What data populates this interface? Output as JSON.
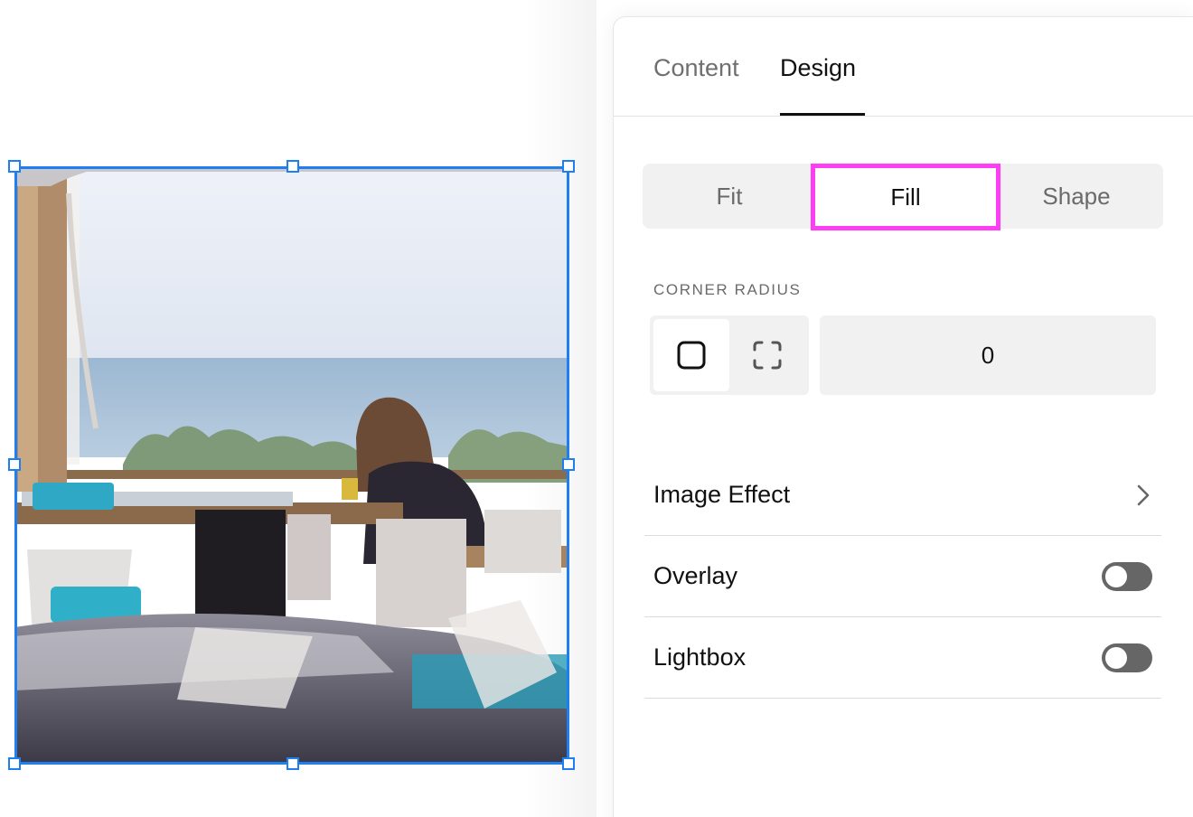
{
  "panel": {
    "tabs": [
      {
        "label": "Content",
        "active": false
      },
      {
        "label": "Design",
        "active": true
      }
    ],
    "fit_mode": {
      "options": [
        "Fit",
        "Fill",
        "Shape"
      ],
      "selected": "Fill",
      "highlight_color": "#ff3df4"
    },
    "corner_radius": {
      "label": "CORNER RADIUS",
      "mode_icons": [
        "square-corners-icon",
        "individual-corners-icon"
      ],
      "value": "0"
    },
    "rows": [
      {
        "label": "Image Effect",
        "control": "chevron-right-icon"
      },
      {
        "label": "Overlay",
        "control": "toggle",
        "enabled": false
      },
      {
        "label": "Lightbox",
        "control": "toggle",
        "enabled": false
      }
    ]
  },
  "selection": {
    "color": "#1f7ff0"
  }
}
